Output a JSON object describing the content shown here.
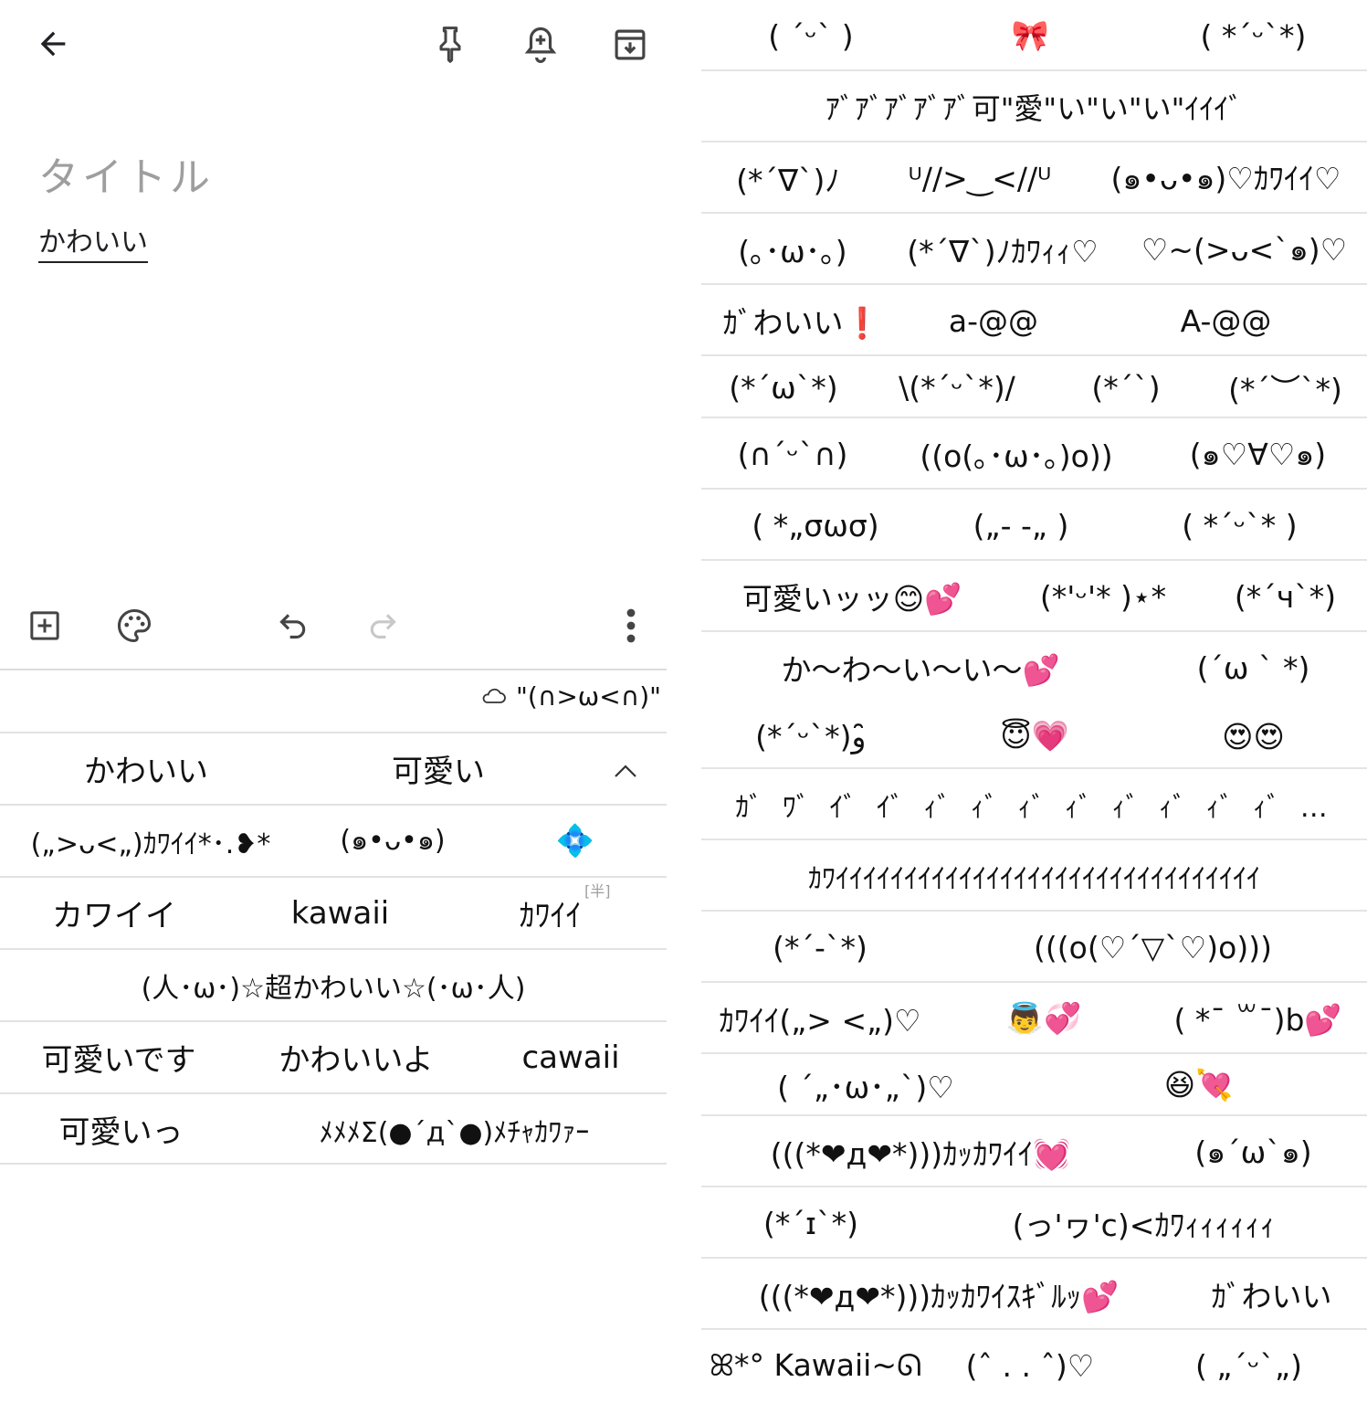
{
  "note": {
    "title_placeholder": "タイトル",
    "body": "かわいい"
  },
  "ime": {
    "preview": "\"(∩>ω<∩)\"",
    "half_badge": "[半]",
    "rows": [
      [
        "かわいい",
        "可愛い"
      ],
      [
        "(„>ᴗ<„)ｶﾜｲｲ*･.❥*",
        "(๑•ᴗ•๑)",
        "💠"
      ],
      [
        "カワイイ",
        "kawaii",
        "ｶﾜｲｲ"
      ],
      [
        "(人･ω･)☆超かわいい☆(･ω･人)"
      ],
      [
        "可愛いです",
        "かわいいよ",
        "cawaii"
      ],
      [
        "可愛いっ",
        "ﾒﾒﾒΣ(●´д`●)ﾒﾁｬｶﾜｧｰ"
      ]
    ]
  },
  "list": {
    "rows": [
      [
        "( ˊᵕˋ )",
        "🎀",
        "( *´ᵕ`*)"
      ],
      [
        "ｱﾞｱﾞｱﾞｱﾞｱﾞ可\"愛\"い\"い\"い\"ｲｲｲﾞ"
      ],
      [
        "(*´∇`)ﾉ",
        "ᵁ//>‿<//ᵁ",
        "(๑•ᴗ•๑)♡ｶﾜｲｲ♡"
      ],
      [
        "(｡･ω･｡)",
        "(*´∇`)ﾉｶﾜｨｨ♡",
        "♡~(>ᴗ<`๑)♡"
      ],
      [
        "ｶﾞわいい❗",
        "a-@@",
        "A-@@"
      ],
      [
        "(*´ω`*)",
        "\\(*ˊᵕˋ*)/",
        "(*´`)",
        "(*´︶`*)"
      ],
      [
        "(∩´ᵕ`∩)",
        "((o(｡･ω･｡)o))",
        "(๑♡∀♡๑)"
      ],
      [
        "( *„σωσ)",
        "(„- -„ )",
        "( *´ᵕ`* )"
      ],
      [
        "可愛いッッ😊💕",
        "(*'ᵕ'* )⋆*",
        "(*´ч`*)"
      ],
      [
        "か〜わ〜い〜い〜💕",
        "(´ω ` *)"
      ],
      [
        "(*´ᵕ`*)ﻭ ̑̑",
        "😇💗",
        "😍😍"
      ],
      [
        "ｶﾞ ﾜﾞ ｲﾞ ｲﾞ ｨﾞ ｨﾞ ｨﾞ ｨﾞ ｨﾞ ｨﾞ ｨﾞ ｨﾞ …"
      ],
      [
        "ｶﾜｲｲｲｲｲｲｲｲｲｲｲｲｲｲｲｲｲｲｲｲｲｲｲｲｲｲｲｲｲｲｲ"
      ],
      [
        "(*´-`*)",
        "(((o(♡´▽`♡)o)))"
      ],
      [
        "ｶﾜｲｲ(„> <„)♡",
        "👼💞",
        "( *¯ ꒳¯)b💕"
      ],
      [
        "( ´„･ω･„`)♡",
        "😆💘"
      ],
      [
        "(((*❤д❤*)))ｶｯｶﾜｲｲ💓",
        "(๑´ω`๑)"
      ],
      [
        "(*´ɪ`*)",
        "(っ'ヮ'c)<ｶﾜｨｨｨｨｨｨ"
      ],
      [
        "(((*❤д❤*)))ｶｯｶﾜｲｽｷﾞﾙｯ💕",
        "ｶﾞわいい"
      ],
      [
        "ꕤ*° Kawaii~ᘏ",
        "(ˆ . . ˆ)♡",
        "( „ˊᵕˋ„)"
      ]
    ]
  },
  "colors": {
    "icon": "#444444",
    "icon_disabled": "#c8c8c8",
    "divider": "#e2e2e2",
    "placeholder": "#9e9e9e"
  }
}
